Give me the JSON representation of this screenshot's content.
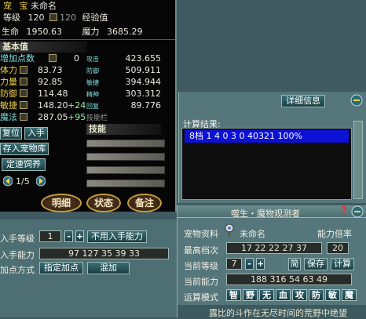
{
  "stats": {
    "name_label": "宠",
    "type_label": "宝",
    "name": "未命名",
    "level_label": "等级",
    "level": "120",
    "level_cap": "120",
    "exp_label": "经验值",
    "hp_label": "生命",
    "hp": "1950.63",
    "mp_label": "魔力",
    "mp": "3685.29"
  },
  "attrs": {
    "title": "基本值",
    "unassigned_label": "增加点数",
    "unassigned": "0",
    "rows": [
      {
        "label": "体力",
        "value": "83.73",
        "rlabel": "攻击",
        "rvalue": "423.655"
      },
      {
        "label": "力量",
        "value": "92.85",
        "rlabel": "防御",
        "rvalue": "509.911"
      },
      {
        "label": "防御",
        "value": "114.48",
        "rlabel": "敏捷",
        "rvalue": "394.944"
      },
      {
        "label": "敏捷",
        "value": "148.20",
        "bonus": "+24",
        "rlabel": "精神",
        "rvalue": "303.312"
      },
      {
        "label": "魔法",
        "value": "287.05",
        "bonus": "+95",
        "rlabel": "回复",
        "rvalue": "89.776"
      }
    ],
    "extra_label": "技能栏"
  },
  "skills": {
    "title": "技能"
  },
  "left_buttons": {
    "reset": "复位",
    "get": "入手",
    "deposit": "存入宠物库",
    "auto_feed": "定速饲养"
  },
  "pager": {
    "text": "1/5"
  },
  "tabs": [
    "明细",
    "状态",
    "备注"
  ],
  "detail_button": "详细信息",
  "result": {
    "title": "计算结果:",
    "line": "8档 1 4 0 3 0 40321 100%"
  },
  "observer": {
    "title": "噬生・魔物观测者",
    "q": "?",
    "pet_label": "宠物资料",
    "pet_name": "未命名",
    "ability_label": "能力倍率",
    "max_label": "最高档次",
    "max_values": "17 22 22 27 37",
    "max_right": "20",
    "cur_level_label": "当前等级",
    "cur_level": "7",
    "simple_btn": "简",
    "save_btn": "保存",
    "calc_btn": "计算",
    "cur_ability_label": "当前能力",
    "cur_ability": "188 316 54 63 49",
    "mode_label": "运算模式",
    "modes": [
      "智",
      "野",
      "无",
      "血",
      "攻",
      "防",
      "敏",
      "魔"
    ],
    "bottom_text": "露比的斗作在无尽时间的荒野中绝望"
  },
  "acquire": {
    "level_label": "入手等级",
    "level": "1",
    "no_ability_btn": "不用入手能力",
    "ability_label": "入手能力",
    "ability": "97 127 35 39 33",
    "method_label": "加点方式",
    "method_btn": "指定加点",
    "mix_btn": "混加"
  },
  "colors": {
    "result_highlight": "#0d11d4",
    "result_text": "#ffffff"
  }
}
